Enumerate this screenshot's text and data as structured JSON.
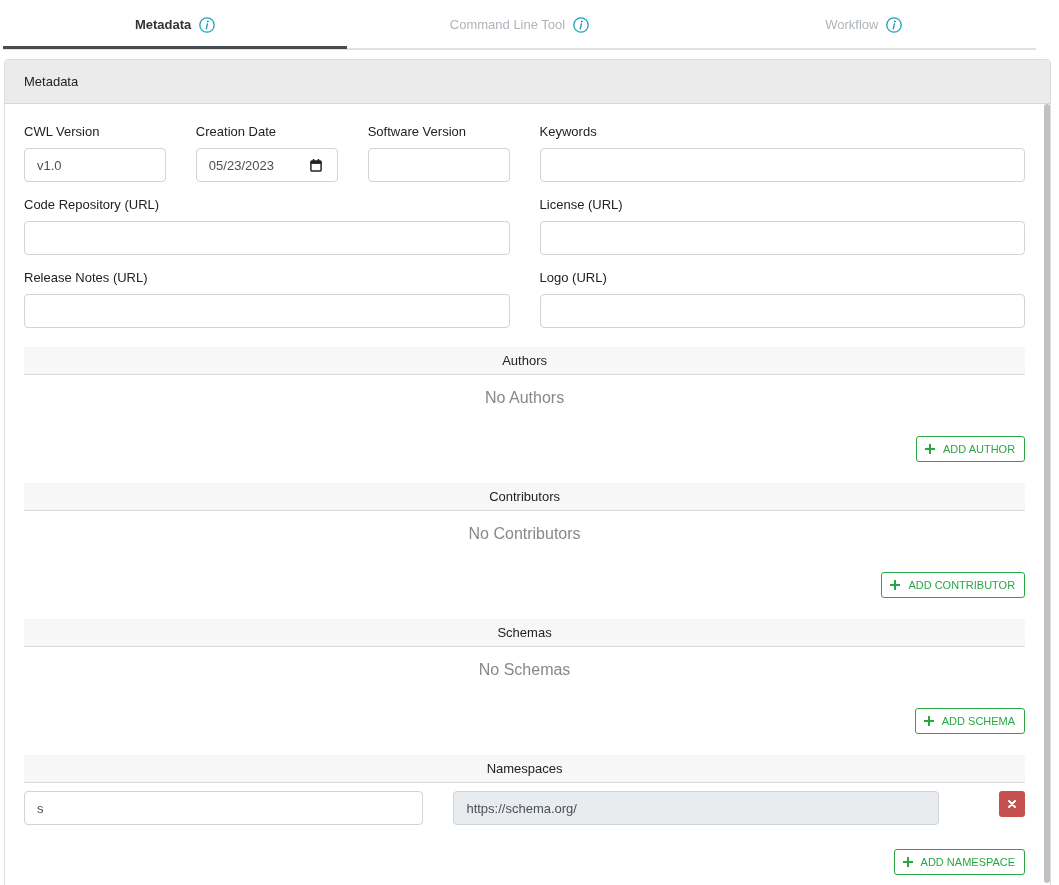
{
  "tabs": [
    {
      "label": "Metadata",
      "selected": true
    },
    {
      "label": "Command Line Tool",
      "selected": false
    },
    {
      "label": "Workflow",
      "selected": false
    }
  ],
  "panel": {
    "title": "Metadata"
  },
  "field_rows": [
    [
      {
        "label": "CWL Version",
        "kind": "text",
        "value": "v1.0"
      },
      {
        "label": "Creation Date",
        "kind": "date",
        "value": "05/23/2023"
      },
      {
        "label": "Software Version",
        "kind": "text"
      },
      {
        "label": "Keywords",
        "kind": "text"
      }
    ],
    [
      {
        "label": "Code Repository (URL)",
        "kind": "text"
      },
      {
        "label": "License (URL)",
        "kind": "text"
      }
    ],
    [
      {
        "label": "Release Notes (URL)",
        "kind": "text"
      },
      {
        "label": "Logo (URL)",
        "kind": "text"
      }
    ]
  ],
  "sections": [
    {
      "title": "Authors",
      "empty_text": "No Authors",
      "add_button": "ADD AUTHOR"
    },
    {
      "title": "Contributors",
      "empty_text": "No Contributors",
      "add_button": "ADD CONTRIBUTOR"
    },
    {
      "title": "Schemas",
      "empty_text": "No Schemas",
      "add_button": "ADD SCHEMA"
    },
    {
      "title": "Namespaces",
      "rows": [
        {
          "prefix": "s",
          "uri": "https://schema.org/",
          "uri_disabled": true
        }
      ],
      "add_button": "ADD NAMESPACE"
    }
  ]
}
